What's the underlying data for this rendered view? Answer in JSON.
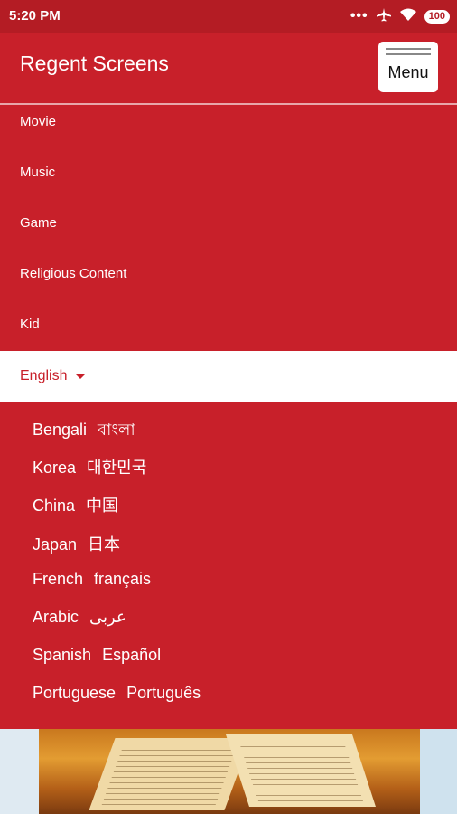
{
  "status_bar": {
    "time": "5:20 PM",
    "dots": "•••",
    "airplane_icon": "airplane-icon",
    "wifi_icon": "wifi-icon",
    "battery": "100"
  },
  "header": {
    "title": "Regent Screens",
    "menu_label": "Menu"
  },
  "nav": {
    "items": [
      {
        "label": "Movie"
      },
      {
        "label": "Music"
      },
      {
        "label": "Game"
      },
      {
        "label": "Religious Content"
      },
      {
        "label": "Kid"
      }
    ]
  },
  "language": {
    "selected": "English",
    "options": [
      {
        "name": "Bengali",
        "native": "বাংলা"
      },
      {
        "name": "Korea",
        "native": "대한민국"
      },
      {
        "name": "China",
        "native": "中国"
      },
      {
        "name": "Japan",
        "native": "日本"
      },
      {
        "name": "French",
        "native": "français"
      },
      {
        "name": "Arabic",
        "native": "عربى"
      },
      {
        "name": "Spanish",
        "native": "Español"
      },
      {
        "name": "Portuguese",
        "native": "Português"
      }
    ]
  },
  "colors": {
    "primary": "#c8202a",
    "status_bar": "#b41c24",
    "text_on_primary": "#ffffff"
  }
}
